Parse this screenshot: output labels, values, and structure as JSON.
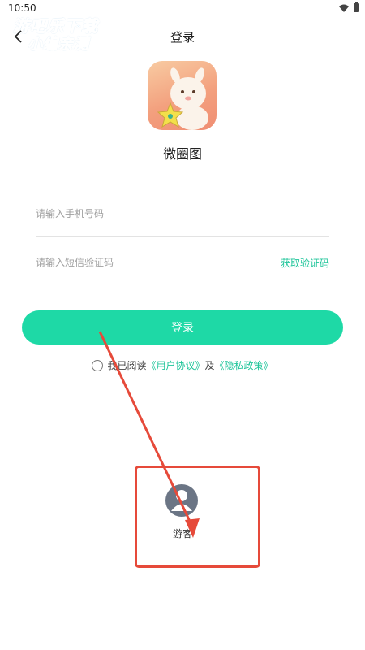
{
  "status_bar": {
    "time": "10:50"
  },
  "watermark": {
    "line1": "游吧乐下载",
    "line2": "小编亲测"
  },
  "header": {
    "title": "登录"
  },
  "app": {
    "name": "微圈图",
    "logo_icon": "alpaca-with-star-icon"
  },
  "form": {
    "phone_placeholder": "请输入手机号码",
    "code_placeholder": "请输入短信验证码",
    "get_code": "获取验证码"
  },
  "login_button": "登录",
  "agreement": {
    "prefix": "我已阅读",
    "user_agreement": "《用户协议》",
    "connector": "及",
    "privacy_policy": "《隐私政策》"
  },
  "guest": {
    "label": "游客"
  },
  "colors": {
    "accent": "#1ED9A6",
    "link": "#1FC59A",
    "annotation": "#E64A3A"
  }
}
